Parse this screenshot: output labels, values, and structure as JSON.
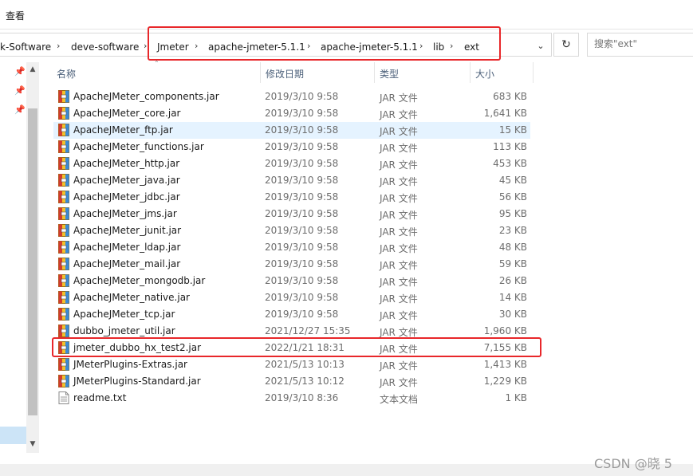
{
  "ribbon": {
    "view_tab": "查看"
  },
  "breadcrumb": [
    {
      "label": "k-Software"
    },
    {
      "label": "deve-software"
    },
    {
      "label": "Jmeter"
    },
    {
      "label": "apache-jmeter-5.1.1"
    },
    {
      "label": "apache-jmeter-5.1.1"
    },
    {
      "label": "lib"
    },
    {
      "label": "ext"
    }
  ],
  "search": {
    "placeholder": "搜索\"ext\""
  },
  "columns": {
    "name": "名称",
    "date": "修改日期",
    "type": "类型",
    "size": "大小"
  },
  "files": [
    {
      "name": "ApacheJMeter_components.jar",
      "date": "2019/3/10 9:58",
      "type": "JAR 文件",
      "size": "683 KB",
      "icon": "jar-archive-icon"
    },
    {
      "name": "ApacheJMeter_core.jar",
      "date": "2019/3/10 9:58",
      "type": "JAR 文件",
      "size": "1,641 KB",
      "icon": "jar-archive-icon"
    },
    {
      "name": "ApacheJMeter_ftp.jar",
      "date": "2019/3/10 9:58",
      "type": "JAR 文件",
      "size": "15 KB",
      "icon": "jar-archive-icon"
    },
    {
      "name": "ApacheJMeter_functions.jar",
      "date": "2019/3/10 9:58",
      "type": "JAR 文件",
      "size": "113 KB",
      "icon": "jar-archive-icon"
    },
    {
      "name": "ApacheJMeter_http.jar",
      "date": "2019/3/10 9:58",
      "type": "JAR 文件",
      "size": "453 KB",
      "icon": "jar-archive-icon"
    },
    {
      "name": "ApacheJMeter_java.jar",
      "date": "2019/3/10 9:58",
      "type": "JAR 文件",
      "size": "45 KB",
      "icon": "jar-archive-icon"
    },
    {
      "name": "ApacheJMeter_jdbc.jar",
      "date": "2019/3/10 9:58",
      "type": "JAR 文件",
      "size": "56 KB",
      "icon": "jar-archive-icon"
    },
    {
      "name": "ApacheJMeter_jms.jar",
      "date": "2019/3/10 9:58",
      "type": "JAR 文件",
      "size": "95 KB",
      "icon": "jar-archive-icon"
    },
    {
      "name": "ApacheJMeter_junit.jar",
      "date": "2019/3/10 9:58",
      "type": "JAR 文件",
      "size": "23 KB",
      "icon": "jar-archive-icon"
    },
    {
      "name": "ApacheJMeter_ldap.jar",
      "date": "2019/3/10 9:58",
      "type": "JAR 文件",
      "size": "48 KB",
      "icon": "jar-archive-icon"
    },
    {
      "name": "ApacheJMeter_mail.jar",
      "date": "2019/3/10 9:58",
      "type": "JAR 文件",
      "size": "59 KB",
      "icon": "jar-archive-icon"
    },
    {
      "name": "ApacheJMeter_mongodb.jar",
      "date": "2019/3/10 9:58",
      "type": "JAR 文件",
      "size": "26 KB",
      "icon": "jar-archive-icon"
    },
    {
      "name": "ApacheJMeter_native.jar",
      "date": "2019/3/10 9:58",
      "type": "JAR 文件",
      "size": "14 KB",
      "icon": "jar-archive-icon"
    },
    {
      "name": "ApacheJMeter_tcp.jar",
      "date": "2019/3/10 9:58",
      "type": "JAR 文件",
      "size": "30 KB",
      "icon": "jar-archive-icon"
    },
    {
      "name": "dubbo_jmeter_util.jar",
      "date": "2021/12/27 15:35",
      "type": "JAR 文件",
      "size": "1,960 KB",
      "icon": "jar-archive-icon"
    },
    {
      "name": "jmeter_dubbo_hx_test2.jar",
      "date": "2022/1/21 18:31",
      "type": "JAR 文件",
      "size": "7,155 KB",
      "icon": "jar-archive-icon"
    },
    {
      "name": "JMeterPlugins-Extras.jar",
      "date": "2021/5/13 10:13",
      "type": "JAR 文件",
      "size": "1,413 KB",
      "icon": "jar-archive-icon"
    },
    {
      "name": "JMeterPlugins-Standard.jar",
      "date": "2021/5/13 10:12",
      "type": "JAR 文件",
      "size": "1,229 KB",
      "icon": "jar-archive-icon"
    },
    {
      "name": "readme.txt",
      "date": "2019/3/10 8:36",
      "type": "文本文档",
      "size": "1 KB",
      "icon": "text-document-icon"
    }
  ],
  "watermark": "CSDN @晓 5",
  "colors": {
    "highlight_border": "#e8272a",
    "hover_row": "#e5f3ff",
    "header_text": "#4c607a"
  }
}
